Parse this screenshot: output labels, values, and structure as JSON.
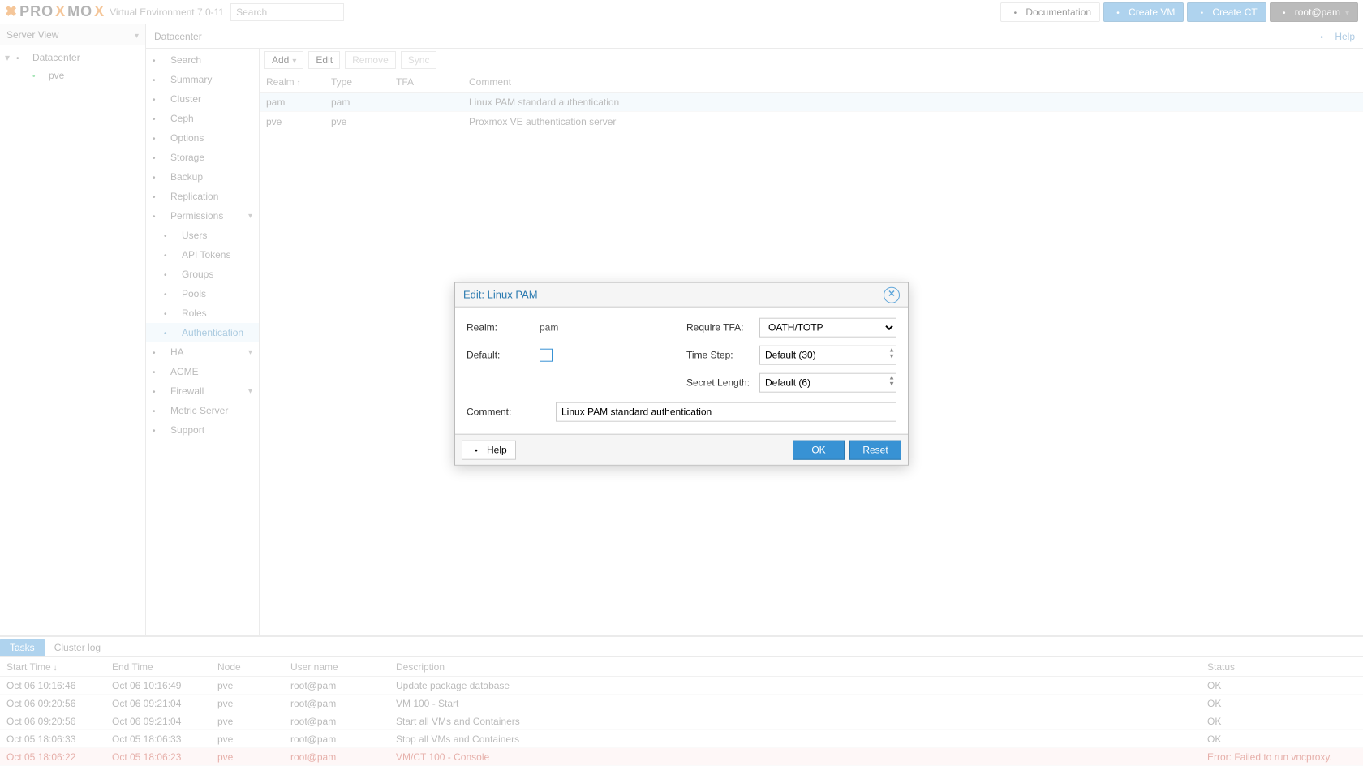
{
  "header": {
    "brand_prefix": "PRO",
    "brand_mid": "X",
    "brand_suffix": "MO",
    "brand_end": "X",
    "ve_label": "Virtual Environment 7.0-11",
    "search_placeholder": "Search",
    "documentation": "Documentation",
    "create_vm": "Create VM",
    "create_ct": "Create CT",
    "user_label": "root@pam"
  },
  "tree": {
    "view_label": "Server View",
    "nodes": [
      {
        "label": "Datacenter",
        "level": 1
      },
      {
        "label": "pve",
        "level": 2
      }
    ]
  },
  "breadcrumb": {
    "path": "Datacenter",
    "help": "Help"
  },
  "menu": {
    "items": [
      {
        "label": "Search",
        "icon": "search-icon"
      },
      {
        "label": "Summary",
        "icon": "list-icon"
      },
      {
        "label": "Cluster",
        "icon": "cluster-icon"
      },
      {
        "label": "Ceph",
        "icon": "ceph-icon"
      },
      {
        "label": "Options",
        "icon": "gear-icon"
      },
      {
        "label": "Storage",
        "icon": "storage-icon"
      },
      {
        "label": "Backup",
        "icon": "backup-icon"
      },
      {
        "label": "Replication",
        "icon": "replication-icon"
      },
      {
        "label": "Permissions",
        "icon": "lock-icon",
        "expand": true
      },
      {
        "label": "Users",
        "icon": "user-icon",
        "sub": true
      },
      {
        "label": "API Tokens",
        "icon": "key-icon",
        "sub": true
      },
      {
        "label": "Groups",
        "icon": "group-icon",
        "sub": true
      },
      {
        "label": "Pools",
        "icon": "pool-icon",
        "sub": true
      },
      {
        "label": "Roles",
        "icon": "role-icon",
        "sub": true
      },
      {
        "label": "Authentication",
        "icon": "auth-icon",
        "sub": true,
        "active": true
      },
      {
        "label": "HA",
        "icon": "ha-icon",
        "expand": true
      },
      {
        "label": "ACME",
        "icon": "acme-icon"
      },
      {
        "label": "Firewall",
        "icon": "firewall-icon",
        "expand": true
      },
      {
        "label": "Metric Server",
        "icon": "metric-icon"
      },
      {
        "label": "Support",
        "icon": "support-icon"
      }
    ]
  },
  "toolbar": {
    "add": "Add",
    "edit": "Edit",
    "remove": "Remove",
    "sync": "Sync"
  },
  "grid": {
    "columns": {
      "realm": "Realm",
      "type": "Type",
      "tfa": "TFA",
      "comment": "Comment"
    },
    "rows": [
      {
        "realm": "pam",
        "type": "pam",
        "tfa": "",
        "comment": "Linux PAM standard authentication",
        "selected": true
      },
      {
        "realm": "pve",
        "type": "pve",
        "tfa": "",
        "comment": "Proxmox VE authentication server"
      }
    ]
  },
  "dialog": {
    "title": "Edit: Linux PAM",
    "realm_label": "Realm:",
    "realm_value": "pam",
    "default_label": "Default:",
    "require_tfa_label": "Require TFA:",
    "require_tfa_value": "OATH/TOTP",
    "time_step_label": "Time Step:",
    "time_step_value": "Default (30)",
    "secret_len_label": "Secret Length:",
    "secret_len_value": "Default (6)",
    "comment_label": "Comment:",
    "comment_value": "Linux PAM standard authentication",
    "help": "Help",
    "ok": "OK",
    "reset": "Reset"
  },
  "bottom": {
    "tabs": {
      "tasks": "Tasks",
      "cluster_log": "Cluster log"
    },
    "columns": {
      "start": "Start Time",
      "end": "End Time",
      "node": "Node",
      "user": "User name",
      "desc": "Description",
      "status": "Status"
    },
    "rows": [
      {
        "start": "Oct 06 10:16:46",
        "end": "Oct 06 10:16:49",
        "node": "pve",
        "user": "root@pam",
        "desc": "Update package database",
        "status": "OK"
      },
      {
        "start": "Oct 06 09:20:56",
        "end": "Oct 06 09:21:04",
        "node": "pve",
        "user": "root@pam",
        "desc": "VM 100 - Start",
        "status": "OK"
      },
      {
        "start": "Oct 06 09:20:56",
        "end": "Oct 06 09:21:04",
        "node": "pve",
        "user": "root@pam",
        "desc": "Start all VMs and Containers",
        "status": "OK"
      },
      {
        "start": "Oct 05 18:06:33",
        "end": "Oct 05 18:06:33",
        "node": "pve",
        "user": "root@pam",
        "desc": "Stop all VMs and Containers",
        "status": "OK"
      },
      {
        "start": "Oct 05 18:06:22",
        "end": "Oct 05 18:06:23",
        "node": "pve",
        "user": "root@pam",
        "desc": "VM/CT 100 - Console",
        "status": "Error: Failed to run vncproxy.",
        "error": true
      }
    ]
  }
}
